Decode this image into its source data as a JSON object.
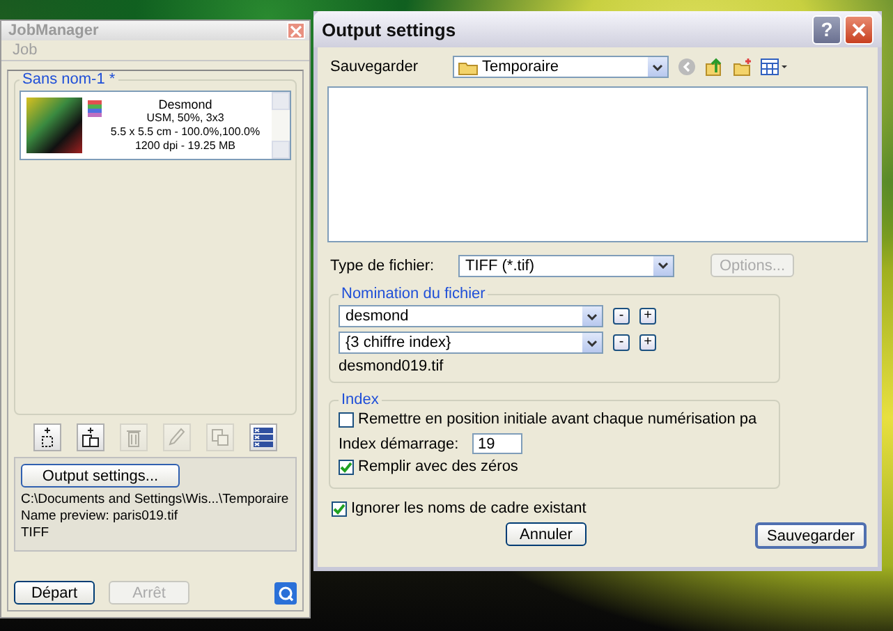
{
  "job_manager": {
    "title": "JobManager",
    "menu": [
      "Job"
    ],
    "job_group": {
      "title": "Sans nom-1 *",
      "items": [
        {
          "name": "Desmond",
          "details": [
            "USM, 50%, 3x3",
            "5.5 x 5.5 cm - 100.0%,100.0%",
            "1200 dpi - 19.25 MB"
          ]
        }
      ]
    },
    "toolbar": [
      {
        "kind": "add-frame",
        "disabled": false
      },
      {
        "kind": "duplicate",
        "disabled": false
      },
      {
        "kind": "delete",
        "disabled": true
      },
      {
        "kind": "edit",
        "disabled": true
      },
      {
        "kind": "copy",
        "disabled": true
      },
      {
        "kind": "batch",
        "disabled": false
      }
    ],
    "output_settings_button": "Output settings...",
    "output_info": [
      "C:\\Documents and Settings\\Wis...\\Temporaire",
      "Name preview: paris019.tif",
      "TIFF"
    ],
    "buttons": [
      {
        "label": "Départ",
        "disabled": false
      },
      {
        "label": "Arrêt",
        "disabled": true
      }
    ]
  },
  "output_settings": {
    "title": "Output settings",
    "help_button": "?",
    "save_in": {
      "label": "Sauvegarder",
      "value": "Temporaire"
    },
    "file_type": {
      "label": "Type de fichier:",
      "value": "TIFF (*.tif)"
    },
    "options_button": {
      "label": "Options...",
      "disabled": true
    },
    "naming": {
      "title": "Nomination du fichier",
      "fields": [
        {
          "value": "desmond",
          "buttons": [
            "-",
            "+"
          ]
        },
        {
          "value": "{3 chiffre index}",
          "buttons": [
            "-",
            "+"
          ]
        }
      ],
      "preview": "desmond019.tif"
    },
    "index": {
      "title": "Index",
      "reset": {
        "label": "Remettre en position initiale avant chaque numérisation pa",
        "checked": false
      },
      "start": {
        "label": "Index démarrage:",
        "value": "19"
      },
      "zero_fill": {
        "label": "Remplir avec des zéros",
        "checked": true
      }
    },
    "ignore": {
      "label": "Ignorer les noms de cadre existant",
      "checked": true
    },
    "buttons": [
      "Annuler",
      "Sauvegarder"
    ]
  }
}
